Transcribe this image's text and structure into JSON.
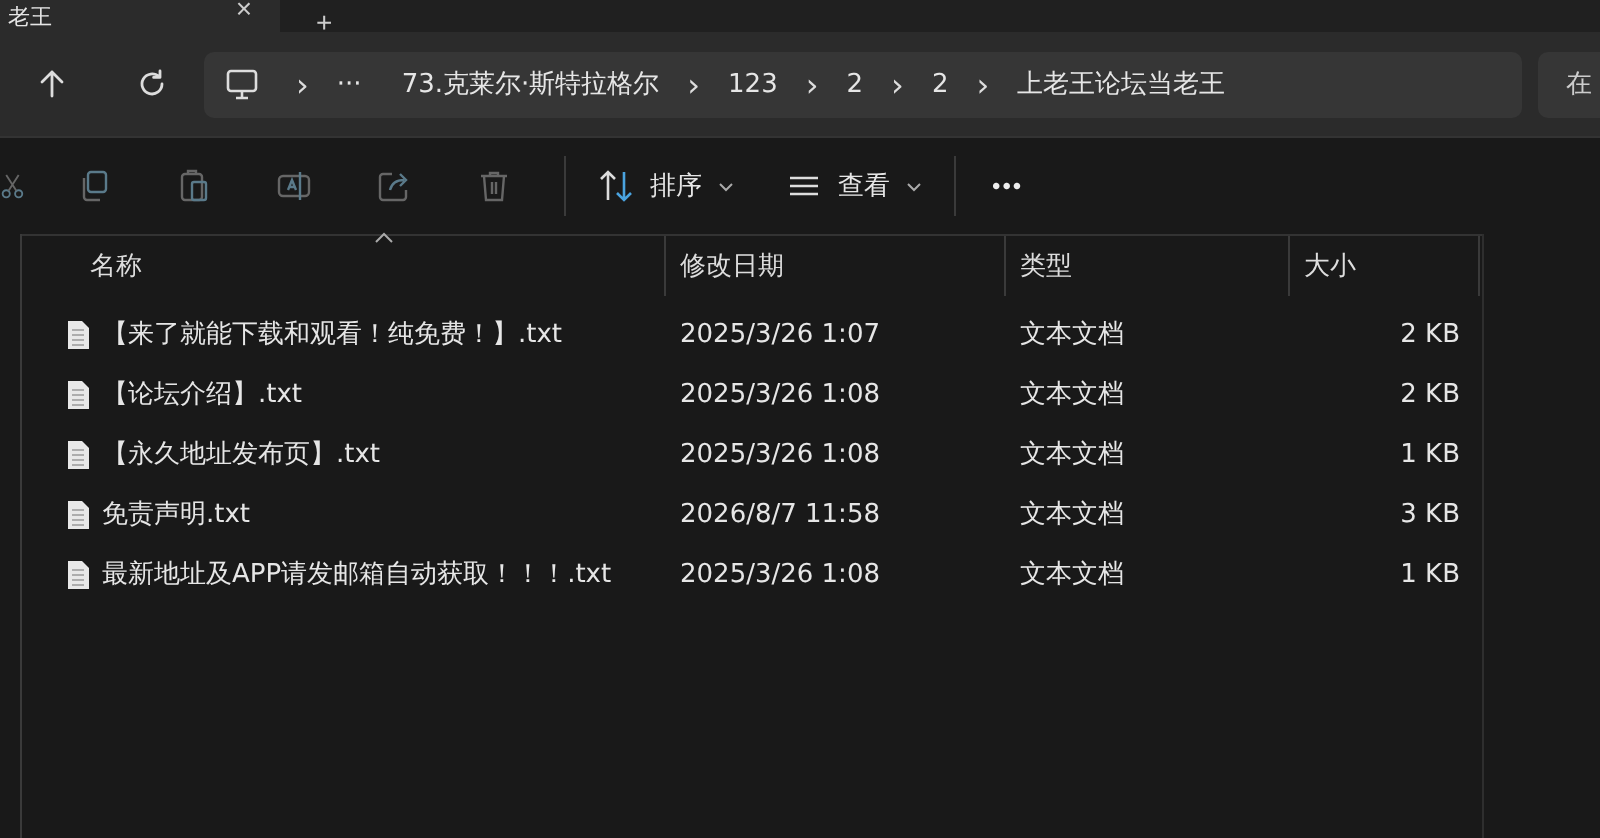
{
  "tab": {
    "title": "老王",
    "close": "×",
    "new_tab": "+"
  },
  "address_bar": {
    "more": "···",
    "path": [
      "73.克莱尔·斯特拉格尔",
      "123",
      "2",
      "2",
      "上老王论坛当老王"
    ],
    "separator": "›"
  },
  "search": {
    "placeholder": "在"
  },
  "toolbar": {
    "sort": "排序",
    "view": "查看",
    "more": "•••"
  },
  "table": {
    "columns": [
      "名称",
      "修改日期",
      "类型",
      "大小"
    ],
    "rows": [
      {
        "name": "【来了就能下载和观看！纯免费！】.txt",
        "date": "2025/3/26 1:07",
        "type": "文本文档",
        "size": "2 KB"
      },
      {
        "name": "【论坛介绍】.txt",
        "date": "2025/3/26 1:08",
        "type": "文本文档",
        "size": "2 KB"
      },
      {
        "name": "【永久地址发布页】.txt",
        "date": "2025/3/26 1:08",
        "type": "文本文档",
        "size": "1 KB"
      },
      {
        "name": "免责声明.txt",
        "date": "2026/8/7 11:58",
        "type": "文本文档",
        "size": "3 KB"
      },
      {
        "name": "最新地址及APP请发邮箱自动获取！！！.txt",
        "date": "2025/3/26 1:08",
        "type": "文本文档",
        "size": "1 KB"
      }
    ]
  }
}
